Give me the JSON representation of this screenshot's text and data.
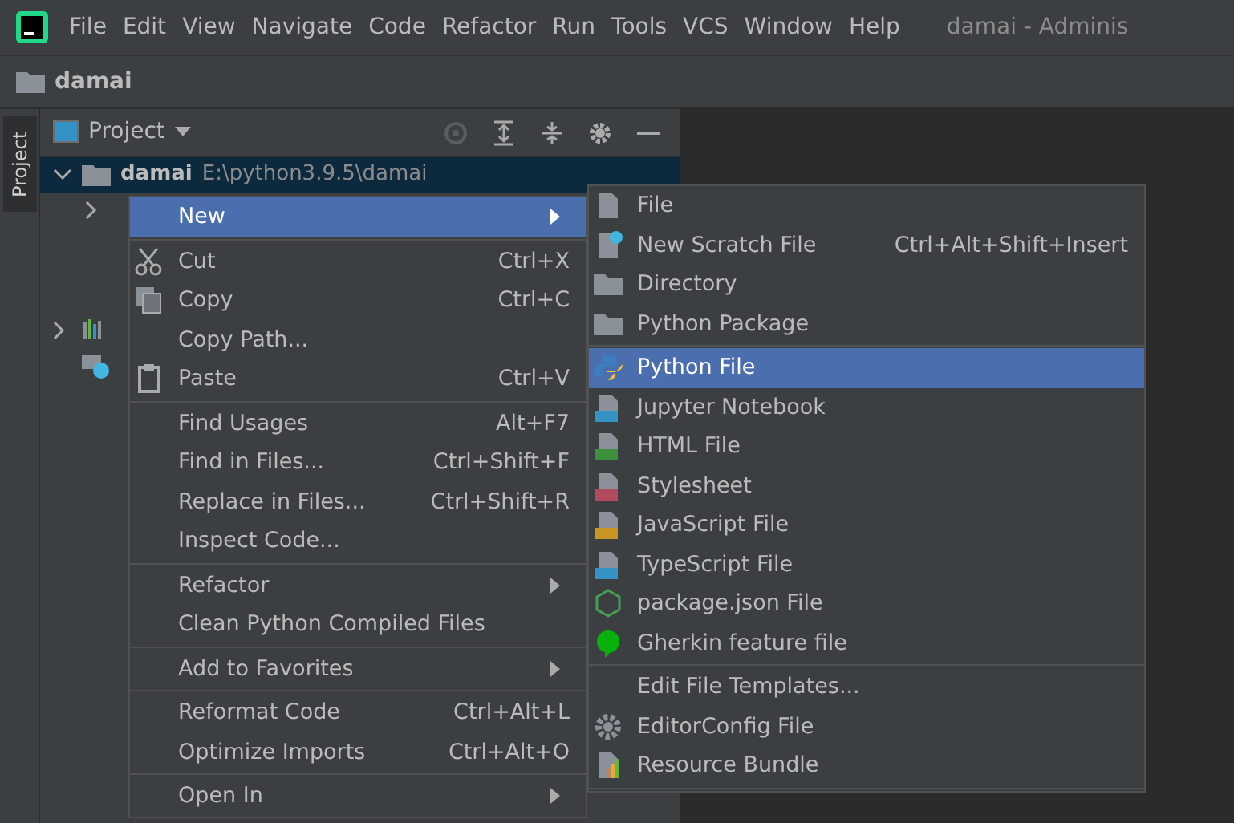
{
  "menubar": {
    "items": [
      "File",
      "Edit",
      "View",
      "Navigate",
      "Code",
      "Refactor",
      "Run",
      "Tools",
      "VCS",
      "Window",
      "Help"
    ],
    "title": "damai - Adminis"
  },
  "breadcrumb": "damai",
  "side_tab": {
    "label": "Project"
  },
  "project_panel": {
    "title": "Project",
    "tree": [
      {
        "label": "damai",
        "path": "E:\\python3.9.5\\damai",
        "selected": true,
        "expanded": true
      },
      {
        "selected": false,
        "expanded": false
      },
      {
        "selected": false,
        "expanded": false
      },
      {
        "selected": false
      }
    ]
  },
  "context_menu": [
    {
      "kind": "item",
      "label": "New",
      "submenu": true,
      "selected": true
    },
    {
      "kind": "separator"
    },
    {
      "kind": "item",
      "label": "Cut",
      "shortcut": "Ctrl+X",
      "selected": false
    },
    {
      "kind": "item",
      "label": "Copy",
      "shortcut": "Ctrl+C",
      "selected": false
    },
    {
      "kind": "item",
      "label": "Copy Path...",
      "selected": false
    },
    {
      "kind": "item",
      "label": "Paste",
      "shortcut": "Ctrl+V",
      "selected": false
    },
    {
      "kind": "separator"
    },
    {
      "kind": "item",
      "label": "Find Usages",
      "shortcut": "Alt+F7",
      "selected": false
    },
    {
      "kind": "item",
      "label": "Find in Files...",
      "shortcut": "Ctrl+Shift+F",
      "selected": false
    },
    {
      "kind": "item",
      "label": "Replace in Files...",
      "shortcut": "Ctrl+Shift+R",
      "selected": false
    },
    {
      "kind": "item",
      "label": "Inspect Code...",
      "selected": false
    },
    {
      "kind": "separator"
    },
    {
      "kind": "item",
      "label": "Refactor",
      "submenu": true,
      "selected": false
    },
    {
      "kind": "item",
      "label": "Clean Python Compiled Files",
      "selected": false
    },
    {
      "kind": "separator"
    },
    {
      "kind": "item",
      "label": "Add to Favorites",
      "submenu": true,
      "selected": false
    },
    {
      "kind": "separator"
    },
    {
      "kind": "item",
      "label": "Reformat Code",
      "shortcut": "Ctrl+Alt+L",
      "selected": false
    },
    {
      "kind": "item",
      "label": "Optimize Imports",
      "shortcut": "Ctrl+Alt+O",
      "selected": false
    },
    {
      "kind": "separator"
    },
    {
      "kind": "item",
      "label": "Open In",
      "submenu": true,
      "selected": false
    }
  ],
  "new_submenu": [
    {
      "kind": "item",
      "label": "File",
      "selected": false
    },
    {
      "kind": "item",
      "label": "New Scratch File",
      "shortcut": "Ctrl+Alt+Shift+Insert",
      "selected": false
    },
    {
      "kind": "item",
      "label": "Directory",
      "selected": false
    },
    {
      "kind": "item",
      "label": "Python Package",
      "selected": false
    },
    {
      "kind": "separator"
    },
    {
      "kind": "item",
      "label": "Python File",
      "selected": true
    },
    {
      "kind": "item",
      "label": "Jupyter Notebook",
      "selected": false
    },
    {
      "kind": "item",
      "label": "HTML File",
      "selected": false
    },
    {
      "kind": "item",
      "label": "Stylesheet",
      "selected": false
    },
    {
      "kind": "item",
      "label": "JavaScript File",
      "selected": false
    },
    {
      "kind": "item",
      "label": "TypeScript File",
      "selected": false
    },
    {
      "kind": "item",
      "label": "package.json File",
      "selected": false
    },
    {
      "kind": "item",
      "label": "Gherkin feature file",
      "selected": false
    },
    {
      "kind": "separator"
    },
    {
      "kind": "item",
      "label": "Edit File Templates...",
      "selected": false
    },
    {
      "kind": "item",
      "label": "EditorConfig File",
      "selected": false
    },
    {
      "kind": "item",
      "label": "Resource Bundle",
      "selected": false
    },
    {
      "kind": "separator"
    }
  ]
}
